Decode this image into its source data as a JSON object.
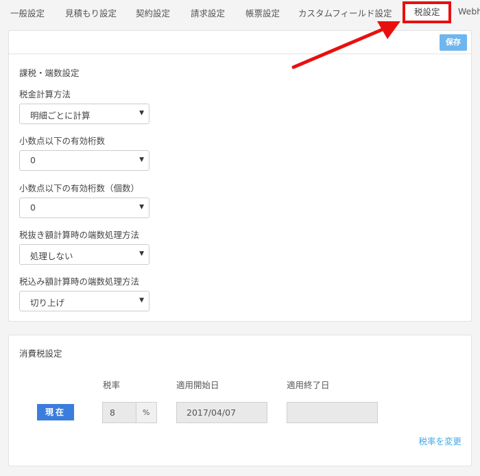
{
  "tabs": [
    {
      "label": "一般設定"
    },
    {
      "label": "見積もり設定"
    },
    {
      "label": "契約設定"
    },
    {
      "label": "請求設定"
    },
    {
      "label": "帳票設定"
    },
    {
      "label": "カスタムフィールド設定"
    },
    {
      "label": "税設定",
      "active": true
    },
    {
      "label": "Webh"
    }
  ],
  "save_label": "保存",
  "tax_section": {
    "title": "課税・端数設定",
    "fields": [
      {
        "label": "税金計算方法",
        "value": "明細ごとに計算"
      },
      {
        "label": "小数点以下の有効桁数",
        "value": "0"
      },
      {
        "label": "小数点以下の有効桁数（個数）",
        "value": "0"
      },
      {
        "label": "税抜き額計算時の端数処理方法",
        "value": "処理しない"
      },
      {
        "label": "税込み額計算時の端数処理方法",
        "value": "切り上げ"
      }
    ]
  },
  "consumption_section": {
    "title": "消費税設定",
    "col_rate": "税率",
    "col_start": "適用開始日",
    "col_end": "適用終了日",
    "current_label": "現在",
    "rate_value": "8",
    "rate_unit": "%",
    "start_date": "2017/04/07",
    "end_date": "",
    "change_link": "税率を変更"
  },
  "colors": {
    "highlight": "#e8100f",
    "save_button": "#6fb6ee",
    "current_badge": "#3b7ddd",
    "link": "#41a9e8"
  }
}
